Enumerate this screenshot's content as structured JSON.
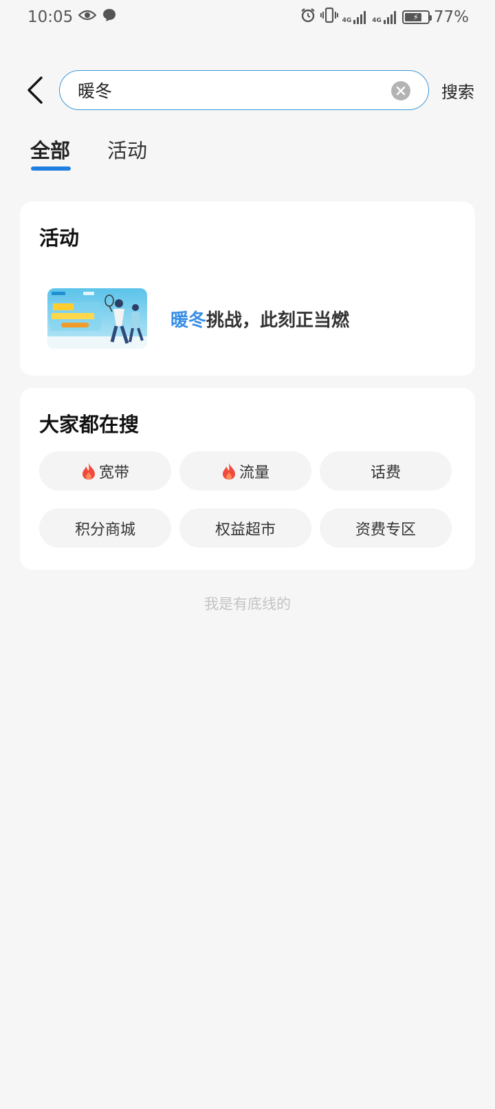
{
  "status_bar": {
    "time": "10:05",
    "battery_percent": "77%",
    "battery_level": 0.77,
    "network_label_1": "4G",
    "network_label_2": "4G"
  },
  "search": {
    "value": "暖冬",
    "button_label": "搜索"
  },
  "tabs": [
    {
      "label": "全部",
      "active": true
    },
    {
      "label": "活动",
      "active": false
    }
  ],
  "activity_section": {
    "title": "活动",
    "items": [
      {
        "title_highlight": "暖冬",
        "title_rest": "挑战，此刻正当燃"
      }
    ]
  },
  "hot_section": {
    "title": "大家都在搜",
    "chips": [
      {
        "label": "宽带",
        "hot": true
      },
      {
        "label": "流量",
        "hot": true
      },
      {
        "label": "话费",
        "hot": false
      },
      {
        "label": "积分商城",
        "hot": false
      },
      {
        "label": "权益超市",
        "hot": false
      },
      {
        "label": "资费专区",
        "hot": false
      }
    ]
  },
  "footer": {
    "text": "我是有底线的"
  },
  "colors": {
    "accent": "#1f7fe0",
    "highlight": "#3a8ee6",
    "search_border": "#3c96d8",
    "background": "#f6f6f6",
    "hot_icon": "#f04a3c"
  }
}
